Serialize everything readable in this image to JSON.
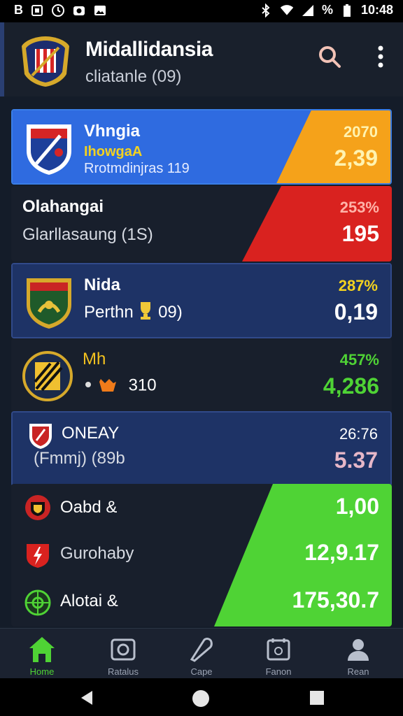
{
  "status_bar": {
    "left_text": "B",
    "battery_text": "%",
    "time": "10:48"
  },
  "header": {
    "title": "Midallidansia",
    "subtitle": "cliatanle (09)"
  },
  "cards": [
    {
      "name": "Vhngia",
      "sub": "IhowgaA",
      "sub2": "Rrotmdinjras 119",
      "pct": "2070",
      "value": "2,39"
    },
    {
      "name": "Olahangai",
      "sub": "Glarllasaung (1S)",
      "sub2": "",
      "pct": "253%",
      "value": "195"
    },
    {
      "name": "Nida",
      "sub": "Perthn",
      "sub2": "",
      "pct": "287%",
      "value": "0,19",
      "sub_suffix": "09)"
    },
    {
      "name": "Mh",
      "sub": "",
      "sub2": "",
      "pct": "457%",
      "value": "4,286",
      "sub_suffix": "310"
    },
    {
      "name": "ONEAY",
      "sub": "(Fmmj) (89b",
      "sub2": "",
      "pct": "26:76",
      "value": "5.37"
    }
  ],
  "rows": [
    {
      "name": "Oabd &",
      "value": "1,00"
    },
    {
      "name": "Gurohaby",
      "value": "12,9.17"
    },
    {
      "name": "Alotai &",
      "value": "175,30.7"
    }
  ],
  "nav": [
    {
      "label": "Home",
      "icon": "home-icon"
    },
    {
      "label": "Ratalus",
      "icon": "camera-icon"
    },
    {
      "label": "Cape",
      "icon": "tag-icon"
    },
    {
      "label": "Fanon",
      "icon": "calendar-icon"
    },
    {
      "label": "Rean",
      "icon": "person-icon"
    }
  ],
  "colors": {
    "accent_blue": "#2f6be0",
    "accent_orange": "#f5a21a",
    "accent_red": "#d9221f",
    "accent_green": "#4fd335",
    "card_dark": "#1c2334",
    "card_navy": "#1e3366"
  }
}
